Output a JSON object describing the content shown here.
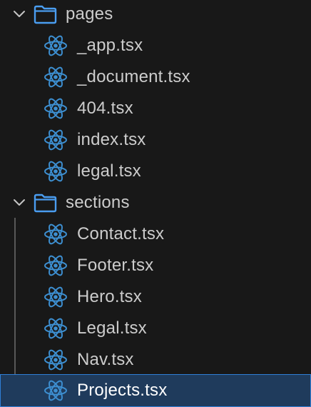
{
  "colors": {
    "background": "#181818",
    "text": "#cccccc",
    "folder_icon": "#4a9df0",
    "react_icon": "#3d8fd1",
    "selected_background": "#1f3b5c",
    "selected_border": "#2f7fd7"
  },
  "tree": {
    "folders": [
      {
        "label": "pages",
        "expanded": true,
        "icon": "folder-icon",
        "files": [
          "_app.tsx",
          "_document.tsx",
          "404.tsx",
          "index.tsx",
          "legal.tsx"
        ]
      },
      {
        "label": "sections",
        "expanded": true,
        "icon": "folder-icon",
        "files": [
          "Contact.tsx",
          "Footer.tsx",
          "Hero.tsx",
          "Legal.tsx",
          "Nav.tsx",
          "Projects.tsx"
        ]
      }
    ],
    "selected_file": "Projects.tsx"
  }
}
